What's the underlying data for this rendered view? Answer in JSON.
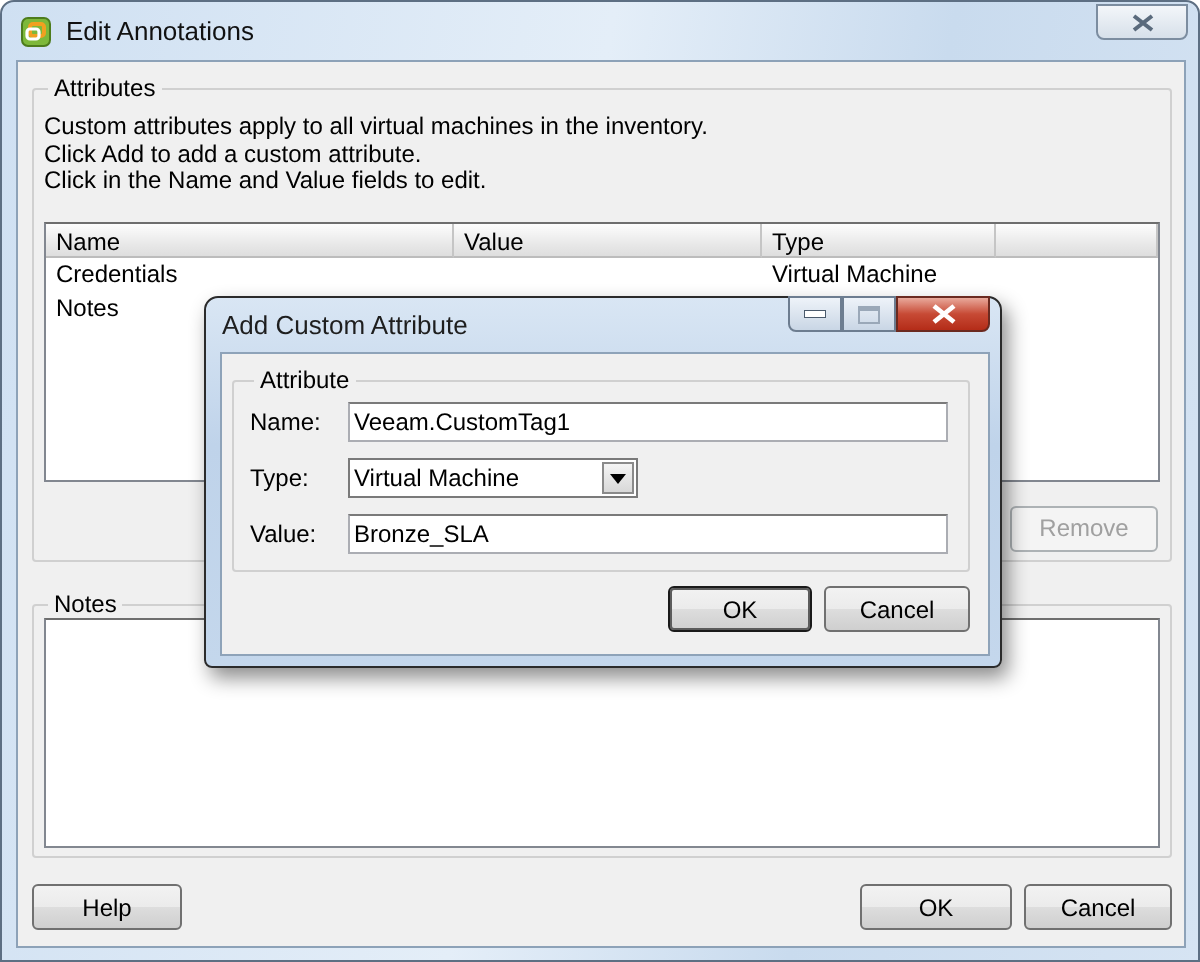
{
  "window": {
    "title": "Edit Annotations"
  },
  "attributes": {
    "legend": "Attributes",
    "description": [
      "Custom attributes apply to all virtual machines in the inventory.",
      "Click Add to add a custom attribute.",
      "Click in the Name and Value fields to edit."
    ],
    "table": {
      "columns": [
        "Name",
        "Value",
        "Type"
      ],
      "rows": [
        {
          "name": "Credentials",
          "type": "Virtual Machine"
        },
        {
          "name": "Notes"
        }
      ]
    },
    "buttons": [
      {
        "label": "Remove",
        "disabled": true
      }
    ]
  },
  "notes": {
    "legend": "Notes"
  },
  "buttons": [
    {
      "label": "Help",
      "disabled": false
    },
    {
      "label": "OK",
      "disabled": false
    },
    {
      "label": "Cancel",
      "disabled": false
    }
  ],
  "dialog": {
    "title": "Add Custom Attribute",
    "legend": "Attribute",
    "fields": [
      {
        "kind": "text",
        "label": "Name:",
        "value": "Veeam.CustomTag1"
      },
      {
        "kind": "dropdown",
        "label": "Type:",
        "value": "Virtual Machine"
      },
      {
        "kind": "text",
        "label": "Value:",
        "value": "Bronze_SLA"
      }
    ],
    "buttons": [
      {
        "label": "OK",
        "default": true
      },
      {
        "label": "Cancel",
        "default": false
      }
    ]
  }
}
